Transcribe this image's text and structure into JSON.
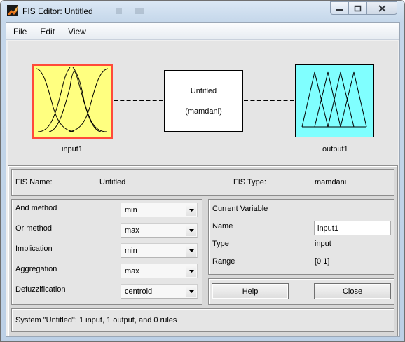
{
  "window": {
    "title": "FIS Editor: Untitled"
  },
  "menu": [
    "File",
    "Edit",
    "View"
  ],
  "diagram": {
    "input_name": "input1",
    "output_name": "output1",
    "fis_name": "Untitled",
    "fis_type_label": "(mamdani)",
    "input_color": "#ffff80",
    "input_border_color": "#ff4a3a",
    "output_color": "#80ffff"
  },
  "fis_info": {
    "name_label": "FIS Name:",
    "name_value": "Untitled",
    "type_label": "FIS Type:",
    "type_value": "mamdani"
  },
  "methods": [
    {
      "label": "And method",
      "value": "min"
    },
    {
      "label": "Or method",
      "value": "max"
    },
    {
      "label": "Implication",
      "value": "min"
    },
    {
      "label": "Aggregation",
      "value": "max"
    },
    {
      "label": "Defuzzification",
      "value": "centroid"
    }
  ],
  "current_variable": {
    "heading": "Current Variable",
    "name_label": "Name",
    "name_value": "input1",
    "type_label": "Type",
    "type_value": "input",
    "range_label": "Range",
    "range_value": "[0 1]"
  },
  "buttons": {
    "help": "Help",
    "close": "Close"
  },
  "status": "System \"Untitled\": 1 input, 1 output, and 0 rules"
}
